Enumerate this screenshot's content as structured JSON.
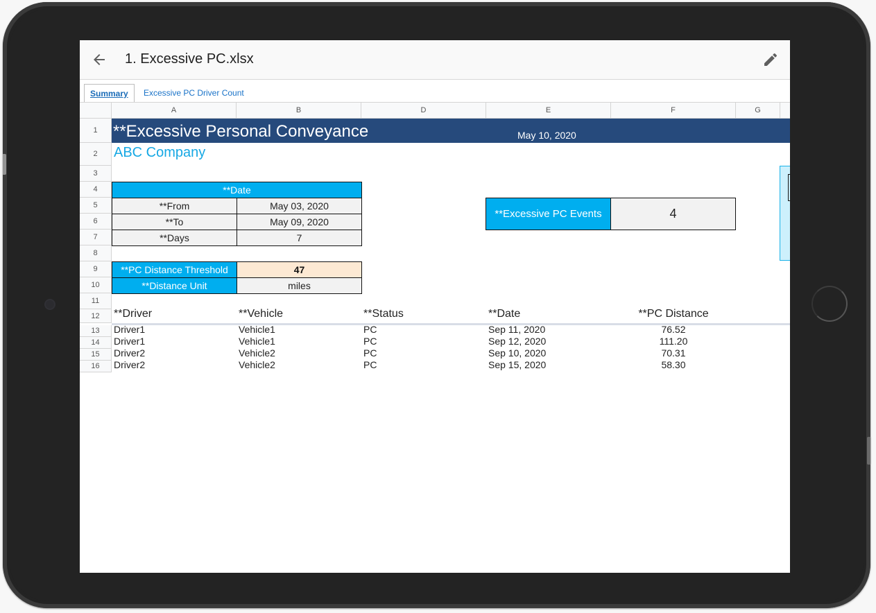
{
  "app": {
    "file_title": "1. Excessive PC.xlsx",
    "back_icon": "arrow-left-icon",
    "edit_icon": "pencil-icon"
  },
  "tabs": [
    {
      "label": "Summary",
      "active": true
    },
    {
      "label": "Excessive PC Driver Count",
      "active": false
    }
  ],
  "columns": [
    "A",
    "B",
    "D",
    "E",
    "F",
    "G"
  ],
  "rows": [
    "1",
    "2",
    "3",
    "4",
    "5",
    "6",
    "7",
    "8",
    "9",
    "10",
    "11",
    "12",
    "13",
    "14",
    "15",
    "16"
  ],
  "report": {
    "title": "**Excessive Personal Conveyance",
    "report_date": "May 10, 2020",
    "company": "ABC Company",
    "date_block": {
      "header": "**Date",
      "from_label": "**From",
      "from_value": "May 03, 2020",
      "to_label": "**To",
      "to_value": "May 09, 2020",
      "days_label": "**Days",
      "days_value": "7"
    },
    "threshold": {
      "label": "**PC Distance Threshold",
      "value": "47",
      "unit_label": "**Distance Unit",
      "unit_value": "miles"
    },
    "events": {
      "label": "**Excessive PC Events",
      "value": "4"
    },
    "table": {
      "headers": [
        "**Driver",
        "**Vehicle",
        "**Status",
        "**Date",
        "**PC Distance"
      ],
      "rows": [
        [
          "Driver1",
          "Vehicle1",
          "PC",
          "Sep 11, 2020",
          "76.52"
        ],
        [
          "Driver1",
          "Vehicle1",
          "PC",
          "Sep 12, 2020",
          "111.20"
        ],
        [
          "Driver2",
          "Vehicle2",
          "PC",
          "Sep 10, 2020",
          "70.31"
        ],
        [
          "Driver2",
          "Vehicle2",
          "PC",
          "Sep 15, 2020",
          "58.30"
        ]
      ]
    }
  },
  "colors": {
    "title_band": "#264a7c",
    "accent_blue": "#00aeef",
    "company_text": "#16a8e4",
    "threshold_fill": "#fde9d3",
    "label_fill": "#f2f2f2"
  }
}
